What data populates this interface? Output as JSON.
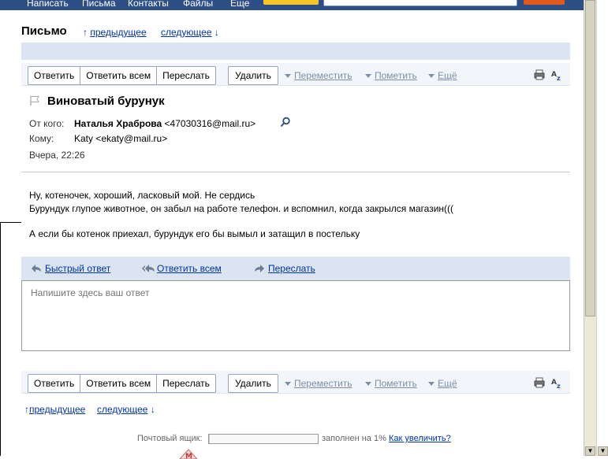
{
  "topnav": {
    "items": [
      "Написать",
      "Письма",
      "Контакты",
      "Файлы",
      "Еще"
    ]
  },
  "header": {
    "title": "Письмо",
    "prev": "предыдущее",
    "next": "следующее"
  },
  "toolbar": {
    "reply": "Ответить",
    "reply_all": "Ответить всем",
    "forward": "Переслать",
    "delete": "Удалить",
    "move": "Переместить",
    "mark": "Пометить",
    "more": "Ещё",
    "print_icon": "print-icon",
    "translate_icon": "translate-icon"
  },
  "message": {
    "subject": "Виноватый бурунук",
    "from_label": "От кого:",
    "from_name": "Наталья Храброва",
    "from_email": "<47030316@mail.ru>",
    "to_label": "Кому:",
    "to_value": "Katy <ekaty@mail.ru>",
    "date": "Вчера, 22:26",
    "body": [
      "Ну, котеночек, хороший, ласковый мой. Не сердись",
      "Бурундук глупое животное, он забыл на работе телефон. и вспомнил, когда закрылся магазин(((",
      "А если бы котенок приехал, бурундук его бы вымыл и затащил в постельку"
    ]
  },
  "quick_reply": {
    "quick": "Быстрый ответ",
    "reply_all": "Ответить всем",
    "forward": "Переслать",
    "placeholder": "Напишите здесь ваш ответ"
  },
  "footer_nav": {
    "prev": "предыдущее",
    "next": "следующее"
  },
  "storage": {
    "label": "Почтовый ящик:",
    "status": "заполнен на 1%",
    "link": "Как увеличить?",
    "fill_percent": 1
  },
  "colors": {
    "accent": "#2e4f86",
    "link": "#0033aa",
    "bar": "#dbe5f1"
  }
}
